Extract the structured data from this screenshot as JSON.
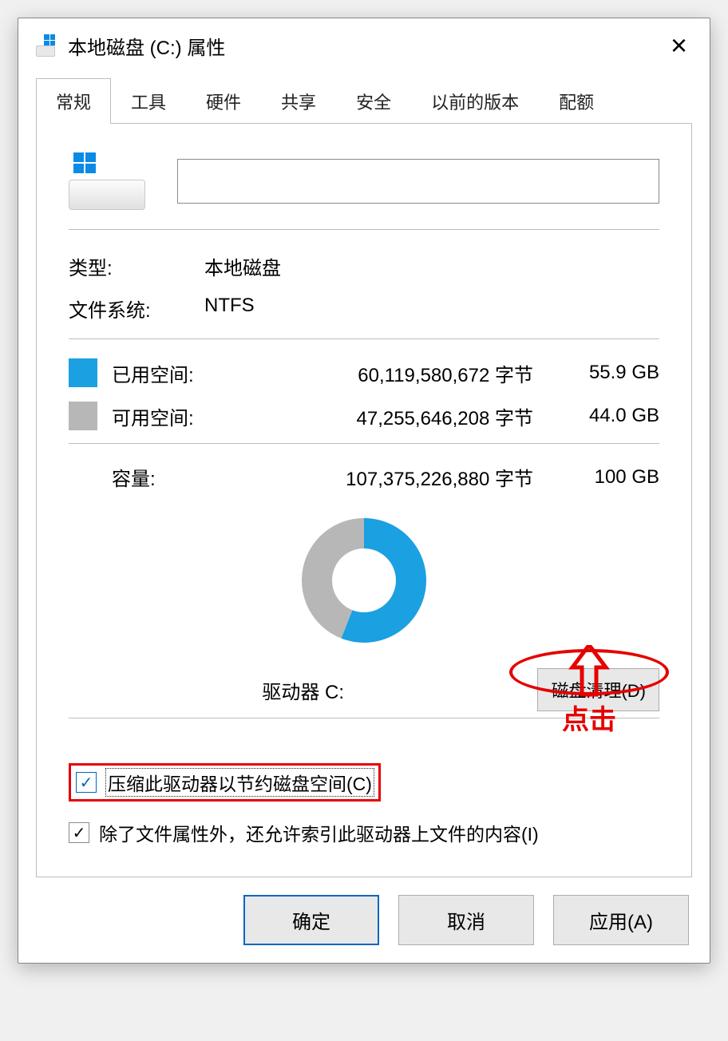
{
  "title": "本地磁盘 (C:) 属性",
  "tabs": [
    "常规",
    "工具",
    "硬件",
    "共享",
    "安全",
    "以前的版本",
    "配额"
  ],
  "active_tab_index": 0,
  "drive_name": "",
  "info": {
    "type_label": "类型:",
    "type_value": "本地磁盘",
    "fs_label": "文件系统:",
    "fs_value": "NTFS"
  },
  "space": {
    "used_label": "已用空间:",
    "used_bytes": "60,119,580,672 字节",
    "used_gb": "55.9 GB",
    "free_label": "可用空间:",
    "free_bytes": "47,255,646,208 字节",
    "free_gb": "44.0 GB"
  },
  "capacity": {
    "label": "容量:",
    "bytes": "107,375,226,880 字节",
    "gb": "100 GB",
    "used_percent": 55.9
  },
  "drive_label": "驱动器 C:",
  "cleanup_btn": "磁盘清理(D)",
  "options": {
    "compress": "压缩此驱动器以节约磁盘空间(C)",
    "index": "除了文件属性外，还允许索引此驱动器上文件的内容(I)"
  },
  "buttons": {
    "ok": "确定",
    "cancel": "取消",
    "apply": "应用(A)"
  },
  "annotation": {
    "click": "点击"
  },
  "chart_data": {
    "type": "pie",
    "title": "",
    "series": [
      {
        "name": "已用空间",
        "value": 55.9,
        "color": "#1ba0e1"
      },
      {
        "name": "可用空间",
        "value": 44.0,
        "color": "#b7b7b7"
      }
    ]
  }
}
